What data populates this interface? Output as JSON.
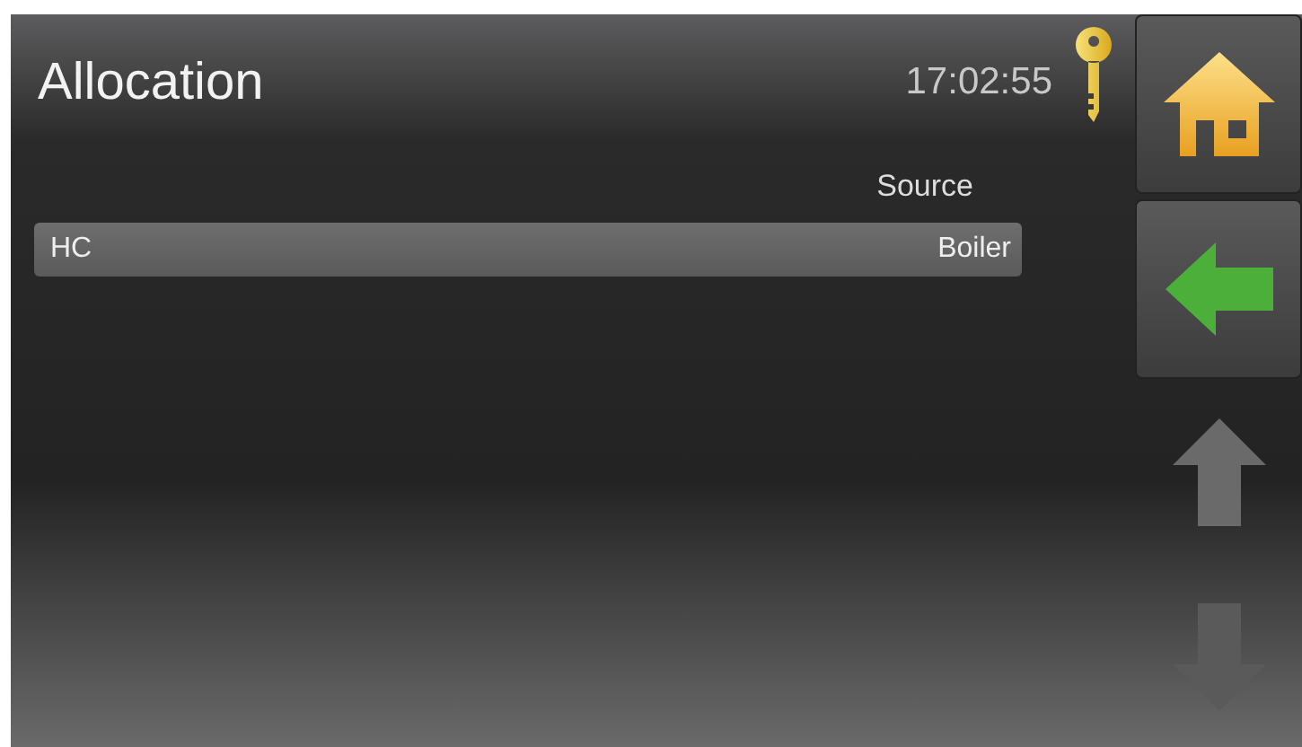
{
  "header": {
    "title": "Allocation",
    "time": "17:02:55"
  },
  "table": {
    "columns": [
      "Source"
    ],
    "rows": [
      {
        "name": "HC",
        "source": "Boiler"
      }
    ]
  },
  "nav_buttons": [
    {
      "kind": "home",
      "disabled": false
    },
    {
      "kind": "back",
      "disabled": false
    },
    {
      "kind": "up",
      "disabled": true
    },
    {
      "kind": "down",
      "disabled": true
    }
  ]
}
